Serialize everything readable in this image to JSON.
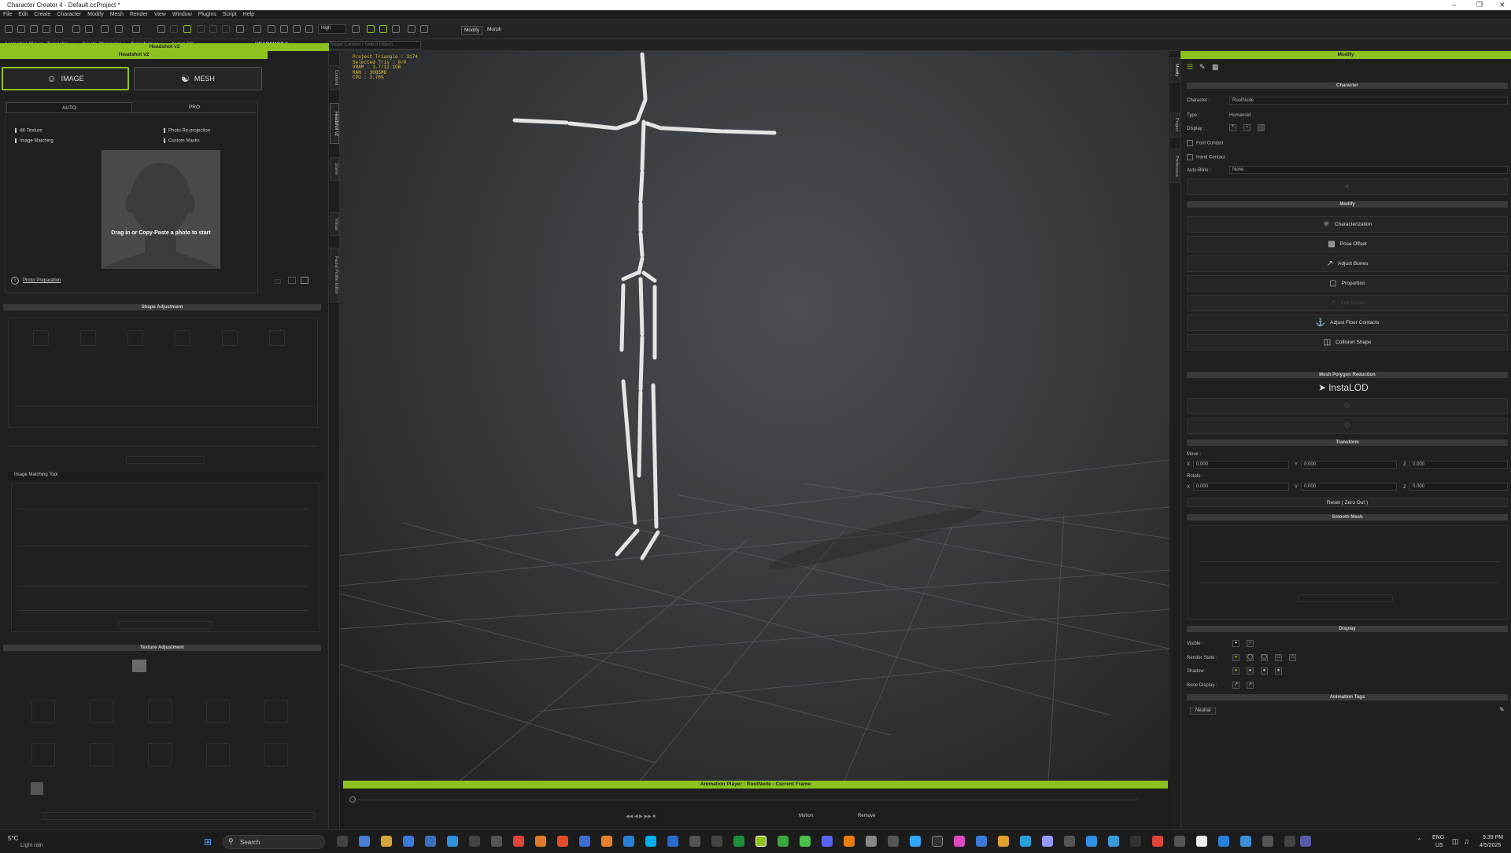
{
  "window": {
    "title": "Character Creator 4 - Default.ccProject *"
  },
  "menu": [
    "File",
    "Edit",
    "Create",
    "Character",
    "Modify",
    "Mesh",
    "Render",
    "View",
    "Window",
    "Plugins",
    "Script",
    "Help"
  ],
  "toolbar": {
    "quality": "High",
    "modify_label": "Modify",
    "morph_label": "Morph"
  },
  "toolbar2": {
    "animation_player": "Animation Player",
    "turntable": "Turntable",
    "create_character": "Create Character",
    "transformer": "Transformer",
    "instalod": "InstaLOD",
    "headshot2": "HEADSHOT 2",
    "search_placeholder": "Target Content / Select Object..."
  },
  "left_panel": {
    "header": "Headshot v2",
    "image_label": "IMAGE",
    "mesh_label": "MESH",
    "tab_auto": "AUTO",
    "tab_pro": "PRO",
    "options": [
      "4K Texture",
      "Photo Re-projection",
      "Image Matching",
      "Custom Masks"
    ],
    "drop_hint": "Drag in or Copy-Paste a photo to start",
    "photo_preparation": "Photo Preparation",
    "shape_adjustment": "Shape Adjustment",
    "image_matching_tool": "Image Matching Tool",
    "texture_adjustment": "Texture Adjustment"
  },
  "side_tabs": [
    "Content",
    "Headshot v2",
    "Scene",
    "Visual",
    "Facial Profile Editor"
  ],
  "right_tabs": [
    "Modify",
    "Project",
    "Preference"
  ],
  "stats": [
    "Project Triangle : 3174",
    "Selected Tris : 0/0",
    "VRAM : 1.7/12.1GB",
    "RAM : 3085MB",
    "CPU : 3.76%"
  ],
  "anim_player": {
    "header": "Animation Player : RootNode - Current Frame",
    "motion": "Motion",
    "remove": "Remove"
  },
  "right_panel": {
    "header": "Modify",
    "character_section": "Character",
    "character_label": "Character :",
    "character_value": "RootNode",
    "type_label": "Type :",
    "type_value": "Humanoid",
    "display_label": "Display :",
    "foot_contact": "Foot Contact",
    "hand_contact": "Hand Contact",
    "auto_blink_label": "Auto-Blink :",
    "auto_blink_value": "None",
    "modify_section": "Modify",
    "buttons": [
      "Characterization",
      "Pose Offset",
      "Adjust Bones",
      "Proportion",
      "Edit Bones",
      "Adjust Floor Contacts",
      "Collision Shape"
    ],
    "mesh_polygon_reduction": "Mesh Polygon Reduction",
    "instalod_logo": "InstaLOD",
    "transform_section": "Transform",
    "move_label": "Move :",
    "rotate_label": "Rotate :",
    "x": "X",
    "y": "Y",
    "z": "Z",
    "zero": "0.000",
    "reset_label": "Reset ( Zero Out )",
    "smooth_mesh": "Smooth Mesh",
    "display_section": "Display",
    "visible_label": "Visible :",
    "render_state_label": "Render State :",
    "shadow_label": "Shadow :",
    "bone_display_label": "Bone Display :",
    "animation_tags": "Animation Tags",
    "tag_neutral": "Neutral"
  },
  "taskbar": {
    "temp": "5°C",
    "weather": "Light rain",
    "search": "Search",
    "lang": "ENG",
    "region": "US",
    "time": "9:39 PM",
    "date": "4/5/2025"
  },
  "colors": {
    "accent": "#8dc21f",
    "stats": "#d8c13a"
  }
}
